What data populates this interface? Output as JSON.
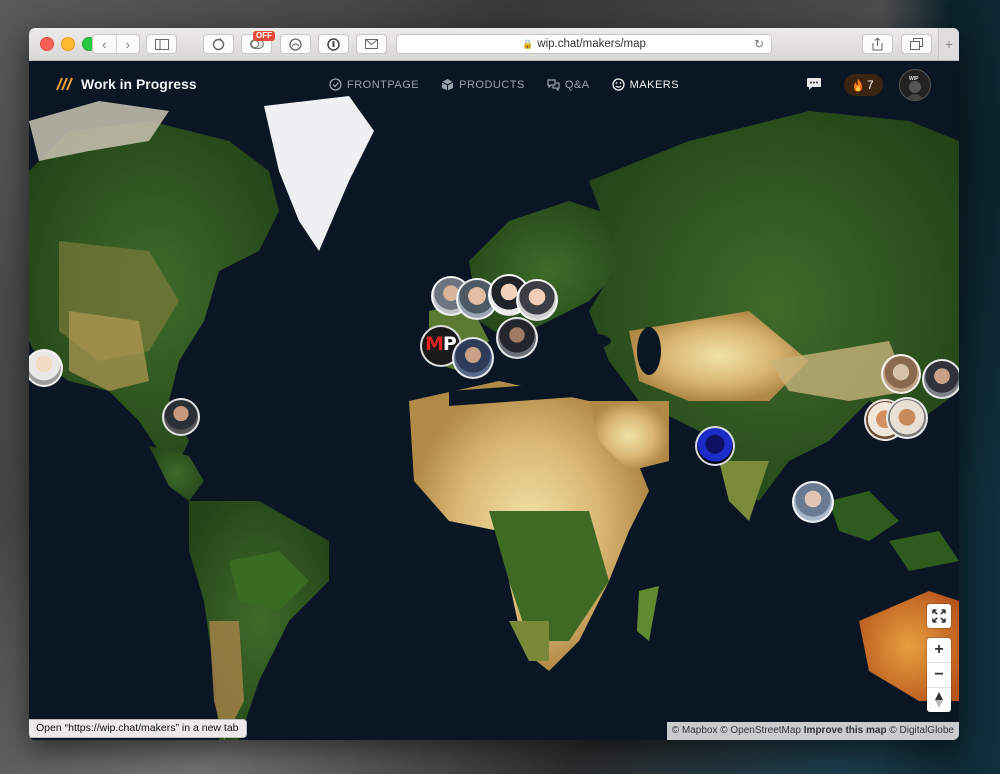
{
  "browser": {
    "url": "wip.chat/makers/map",
    "extension_badge": "OFF",
    "status_text": "Open “https://wip.chat/makers” in a new tab"
  },
  "nav": {
    "brand": "Work in Progress",
    "links": [
      {
        "label": "FRONTPAGE",
        "icon": "check-circle-icon",
        "active": false
      },
      {
        "label": "PRODUCTS",
        "icon": "cube-icon",
        "active": false
      },
      {
        "label": "Q&A",
        "icon": "chat-bubbles-icon",
        "active": false
      },
      {
        "label": "MAKERS",
        "icon": "smiley-icon",
        "active": true
      }
    ],
    "streak_count": "7",
    "avatar_label": "WIP"
  },
  "map": {
    "controls": {
      "zoom_in": "+",
      "zoom_out": "−",
      "fullscreen_icon": "expand-icon",
      "compass_icon": "compass-icon"
    },
    "attribution": {
      "mapbox": "© Mapbox",
      "osm": "© OpenStreetMap",
      "improve": "Improve this map",
      "globe": "© DigitalGlobe"
    },
    "markers": [
      {
        "name": "maker-avatar-sf"
      },
      {
        "name": "maker-avatar-florida"
      },
      {
        "name": "maker-avatar-europe-1"
      },
      {
        "name": "maker-avatar-europe-2"
      },
      {
        "name": "maker-avatar-europe-3"
      },
      {
        "name": "maker-avatar-europe-4"
      },
      {
        "name": "maker-avatar-europe-5"
      },
      {
        "name": "maker-avatar-mp",
        "text": "MP"
      },
      {
        "name": "maker-avatar-spain"
      },
      {
        "name": "maker-avatar-india"
      },
      {
        "name": "maker-avatar-indonesia"
      },
      {
        "name": "maker-avatar-asia-1"
      },
      {
        "name": "maker-avatar-asia-2"
      },
      {
        "name": "maker-avatar-asia-3"
      }
    ]
  },
  "colors": {
    "accent_fire": "#ff7a1a",
    "ocean": "#0b1624"
  }
}
